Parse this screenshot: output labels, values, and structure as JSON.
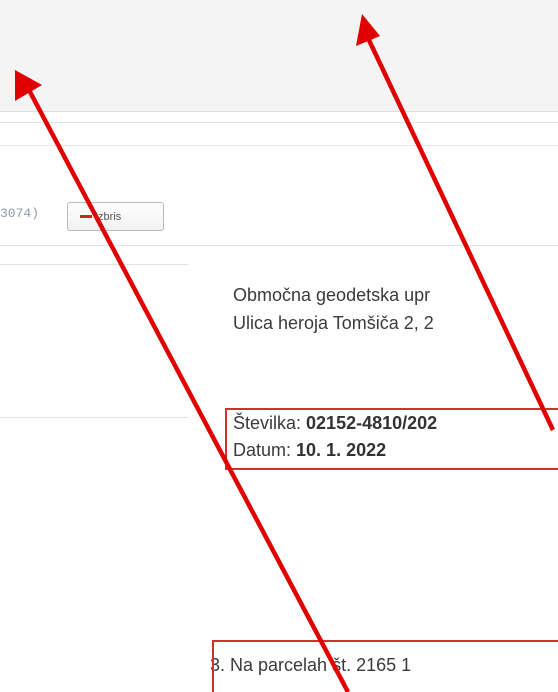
{
  "toolbar": {
    "id_fragment": "3074)",
    "delete_label": "Izbris"
  },
  "document": {
    "office_line": "Območna geodetska upr",
    "address_line": "Ulica heroja Tomšiča 2, 2",
    "number_label": "Številka: ",
    "number_value": "02152-4810/202",
    "date_label": "Datum: ",
    "date_value": "10. 1. 2022",
    "parcel_line": "3. Na parcelah št. 2165 1"
  },
  "colors": {
    "arrow": "#e00000",
    "highlight": "#d32f2f",
    "delete_icon": "#c62828"
  }
}
